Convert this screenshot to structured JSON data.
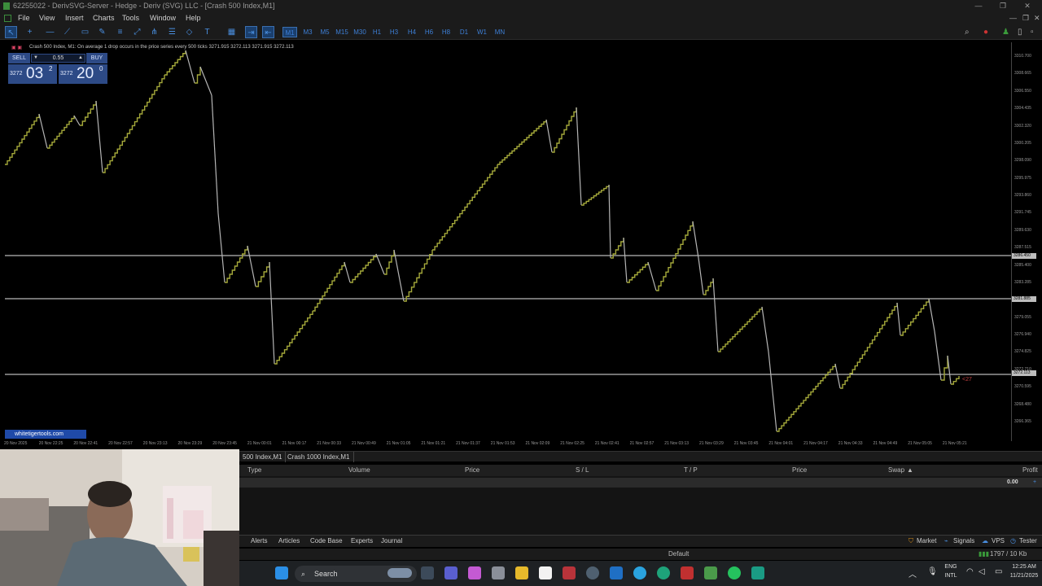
{
  "window": {
    "title": "62255022 - DerivSVG-Server - Hedge - Deriv (SVG) LLC - [Crash 500 Index,M1]",
    "controls": [
      "—",
      "❐",
      "✕"
    ]
  },
  "menu": {
    "items": [
      "File",
      "View",
      "Insert",
      "Charts",
      "Tools",
      "Window",
      "Help"
    ],
    "mdi_controls": [
      "—",
      "❐",
      "✕"
    ]
  },
  "toolbar": {
    "timeframes": [
      "M1",
      "M3",
      "M5",
      "M15",
      "M30",
      "H1",
      "H3",
      "H4",
      "H6",
      "H8",
      "D1",
      "W1",
      "MN"
    ],
    "active_timeframe": "M1",
    "icons": [
      "cursor-icon",
      "crosshair-icon",
      "horizontal-line-icon",
      "trendline-icon",
      "rectangle-icon",
      "pencil-icon",
      "channel-icon",
      "ray-icon",
      "pitchfork-icon",
      "fibonacci-icon",
      "shapes-icon",
      "text-icon",
      "grid-icon",
      "autoscroll-icon",
      "chart-shift-icon"
    ]
  },
  "chart": {
    "info_line": "Crash 500 Index, M1:  On average 1 drop occurs in the price series every 500 ticks  3271.915 3272.113 3271.915 3272.113",
    "watermark": "whitetigertools.com",
    "last_price_marker": "<27",
    "price_lines": [
      "3286.450",
      "3281.885",
      "3272.113"
    ],
    "price_ticks": [
      "3310.700",
      "3308.665",
      "3306.550",
      "3304.435",
      "3302.320",
      "3300.205",
      "3298.090",
      "3295.975",
      "3293.860",
      "3291.745",
      "3289.630",
      "3287.515",
      "3285.400",
      "3283.285",
      "3281.170",
      "3279.055",
      "3276.940",
      "3274.825",
      "3272.710",
      "3270.595",
      "3268.480",
      "3266.365"
    ],
    "time_ticks": [
      "20 Nov 2025",
      "20 Nov 22:25",
      "20 Nov 22:41",
      "20 Nov 22:57",
      "20 Nov 23:13",
      "20 Nov 23:29",
      "20 Nov 23:45",
      "21 Nov 00:01",
      "21 Nov 00:17",
      "21 Nov 00:33",
      "21 Nov 00:49",
      "21 Nov 01:05",
      "21 Nov 01:21",
      "21 Nov 01:37",
      "21 Nov 01:53",
      "21 Nov 02:09",
      "21 Nov 02:25",
      "21 Nov 02:41",
      "21 Nov 02:57",
      "21 Nov 03:13",
      "21 Nov 03:29",
      "21 Nov 03:45",
      "21 Nov 04:01",
      "21 Nov 04:17",
      "21 Nov 04:33",
      "21 Nov 04:49",
      "21 Nov 05:05",
      "21 Nov 05:21"
    ]
  },
  "trade_panel": {
    "sell_label": "SELL",
    "buy_label": "BUY",
    "lot": "0.55",
    "bid_prefix": "3272",
    "bid_big": "03",
    "bid_sup": "2",
    "ask_prefix": "3272",
    "ask_big": "20",
    "ask_sup": "0"
  },
  "chart_tabs": [
    "500 Index,M1",
    "Crash 1000 Index,M1"
  ],
  "toolbox": {
    "columns": [
      "Type",
      "Volume",
      "Price",
      "S / L",
      "T / P",
      "Price",
      "Swap",
      "Profit"
    ],
    "balance_value": "0.00",
    "tabs": [
      "Alerts",
      "Articles",
      "Code Base",
      "Experts",
      "Journal"
    ],
    "right_tabs": [
      "Market",
      "Signals",
      "VPS",
      "Tester"
    ]
  },
  "statusbar": {
    "profile": "Default",
    "traffic": "1797 / 10 Kb"
  },
  "taskbar": {
    "search_label": "Search",
    "lang_top": "ENG",
    "lang_bottom": "INTL",
    "time": "12:25 AM",
    "date": "11/21/2025"
  },
  "colors": {
    "candle": "#a4a83a",
    "drop_line": "#b5b5b5",
    "hline": "#e6e6e6",
    "accent_blue": "#2d4a86"
  }
}
